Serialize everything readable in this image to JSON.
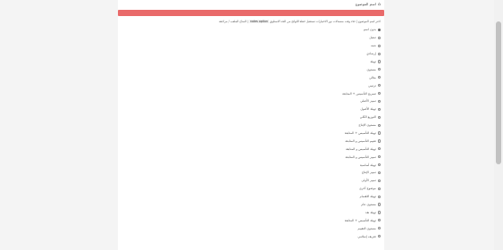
{
  "header": {
    "title": "اسم الموضوع",
    "icon": "home-icon"
  },
  "question": {
    "prefix": "اختر اسم الموضوع",
    "text": "  | حدّد وقت منسدلات نور الاختيارات تستقبل خطة اللوائح من الحد الاستلوي",
    "highlight": "notes option",
    "suffix": "| المتاح الملعب / مراجعة"
  },
  "options": [
    {
      "label": "بدون اسم",
      "checked": true
    },
    {
      "label": "تمثيل",
      "checked": false
    },
    {
      "label": "شبه",
      "checked": false
    },
    {
      "label": "إرشادي",
      "checked": false
    },
    {
      "label": "تهيئة",
      "checked": false
    },
    {
      "label": "مستوى",
      "checked": false
    },
    {
      "label": "مثالي",
      "checked": false
    },
    {
      "label": "ترتيبي",
      "checked": false
    },
    {
      "label": "تسريح التأسيس + المتابعة",
      "checked": false
    },
    {
      "label": "تمييز الأصلي",
      "checked": false
    },
    {
      "label": "تهيئة الأصول",
      "checked": false
    },
    {
      "label": "التوزيع الكلي",
      "checked": false
    },
    {
      "label": "مستوى الإنتاج",
      "checked": false
    },
    {
      "label": "تهيئة التأسيس + المتابعة",
      "checked": false
    },
    {
      "label": "تقييم التأسيس و المتابعة",
      "checked": false
    },
    {
      "label": "تهيئة التأسيس و المتابعة",
      "checked": false
    },
    {
      "label": "تمييز التأسيس و المتابعة",
      "checked": false
    },
    {
      "label": "تهيئة أساسية",
      "checked": false
    },
    {
      "label": "تمييز الإنتاج",
      "checked": false
    },
    {
      "label": "تمييز الأولى",
      "checked": false
    },
    {
      "label": "موضوع أخرى",
      "checked": false
    },
    {
      "label": "تهيئة الاهتمام",
      "checked": false
    },
    {
      "label": "مستوى عام",
      "checked": false
    },
    {
      "label": "تهيئة نقد",
      "checked": false
    },
    {
      "label": "تهيئة التأسيس + المتابعة",
      "checked": false
    },
    {
      "label": "مستوى التقييم",
      "checked": false
    },
    {
      "label": "تعريف إسلامي",
      "checked": false
    }
  ],
  "colors": {
    "alert": "#e96a6a",
    "background": "#f4f4f4"
  }
}
